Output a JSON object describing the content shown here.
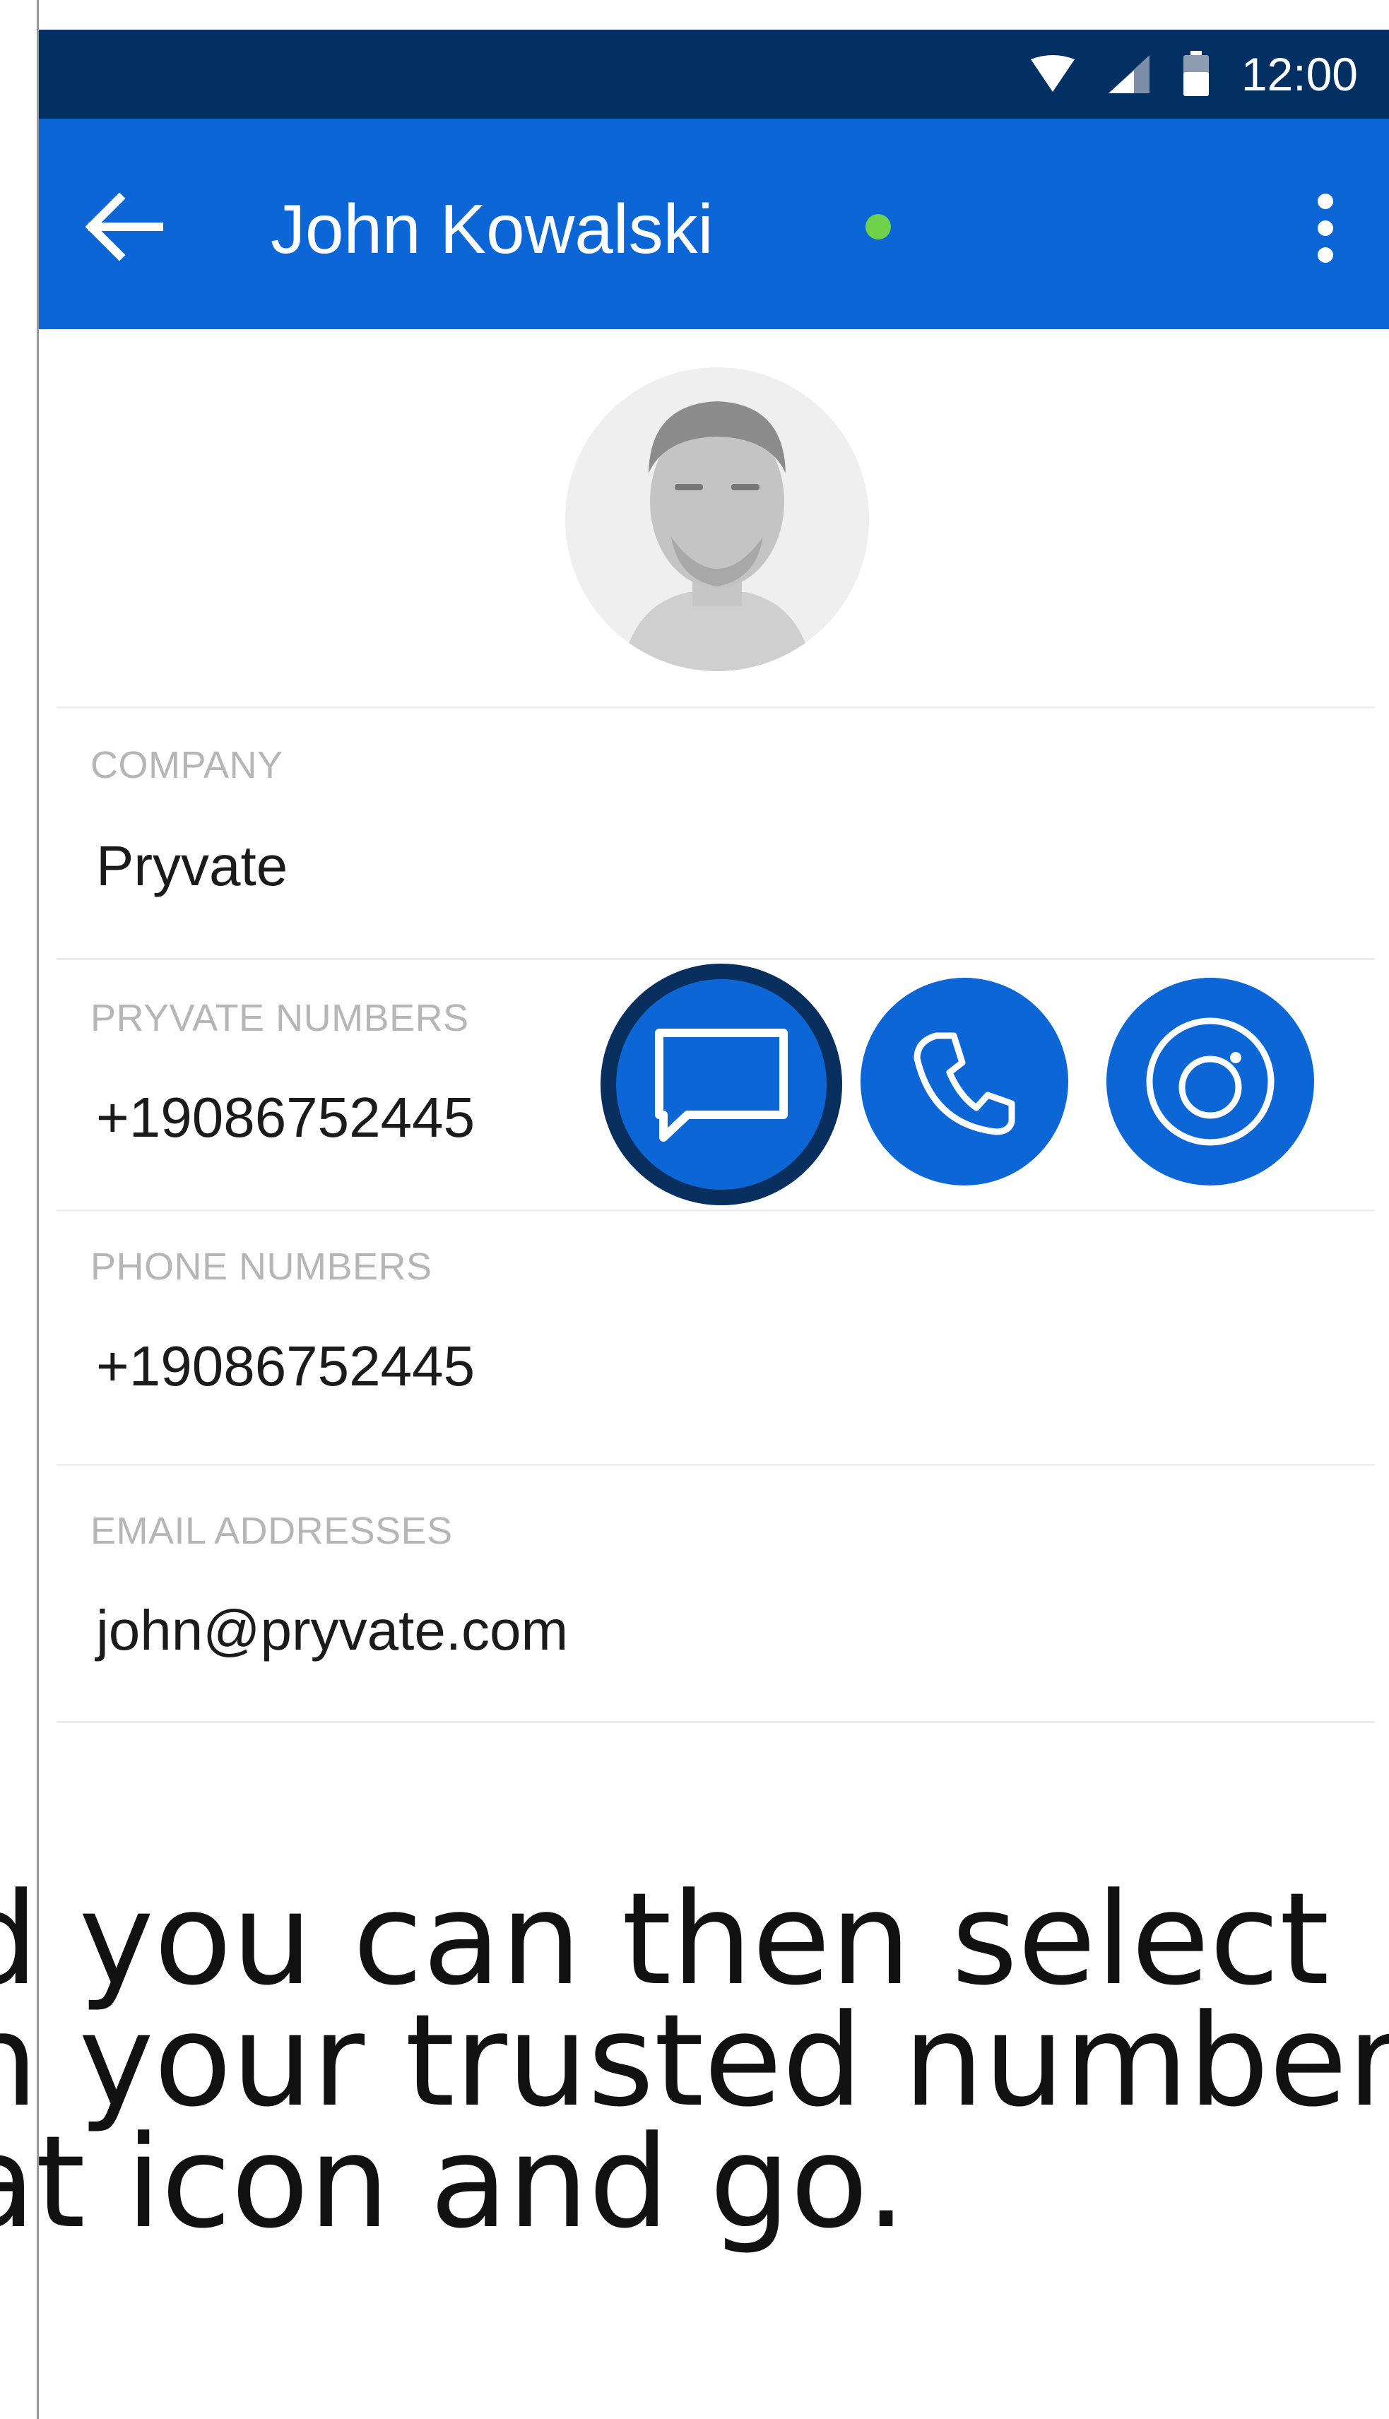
{
  "status_bar": {
    "time": "12:00",
    "icons": [
      "wifi-icon",
      "signal-icon",
      "battery-icon"
    ]
  },
  "header": {
    "title": "John Kowalski",
    "presence": "online",
    "back_icon": "arrow-back-icon",
    "menu_icon": "more-vert-icon"
  },
  "contact": {
    "avatar": "profile-photo",
    "fields": [
      {
        "label": "COMPANY",
        "value": "Pryvate"
      },
      {
        "label": "PRYVATE NUMBERS",
        "value": "+19086752445"
      },
      {
        "label": "PHONE NUMBERS",
        "value": "+19086752445"
      },
      {
        "label": "EMAIL ADDRESSES",
        "value": "john@pryvate.com"
      }
    ],
    "actions": [
      {
        "icon": "chat-icon",
        "selected": true
      },
      {
        "icon": "phone-icon",
        "selected": false
      },
      {
        "icon": "video-icon",
        "selected": false
      }
    ]
  },
  "caption": {
    "lines": [
      "d you can then select",
      "n your trusted number",
      "at icon and go."
    ]
  },
  "colors": {
    "status_bar": "#033063",
    "app_bar": "#0d66d5",
    "accent": "#0d66d5",
    "selected_ring": "#092f5e",
    "presence": "#6ed34a"
  }
}
